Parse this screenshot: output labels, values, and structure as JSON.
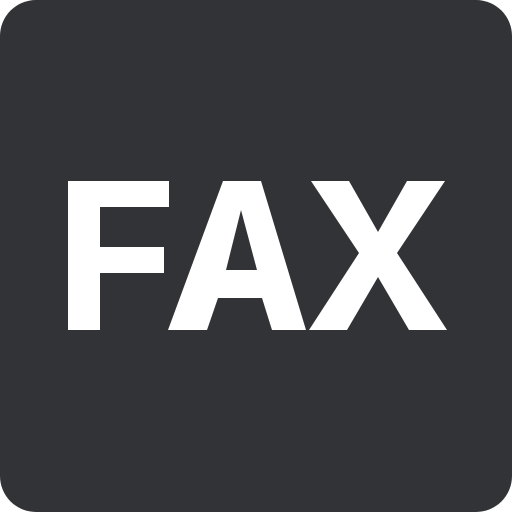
{
  "icon": {
    "text": "FAX",
    "name": "fax-icon",
    "background_color": "#323337",
    "text_color": "#ffffff"
  }
}
